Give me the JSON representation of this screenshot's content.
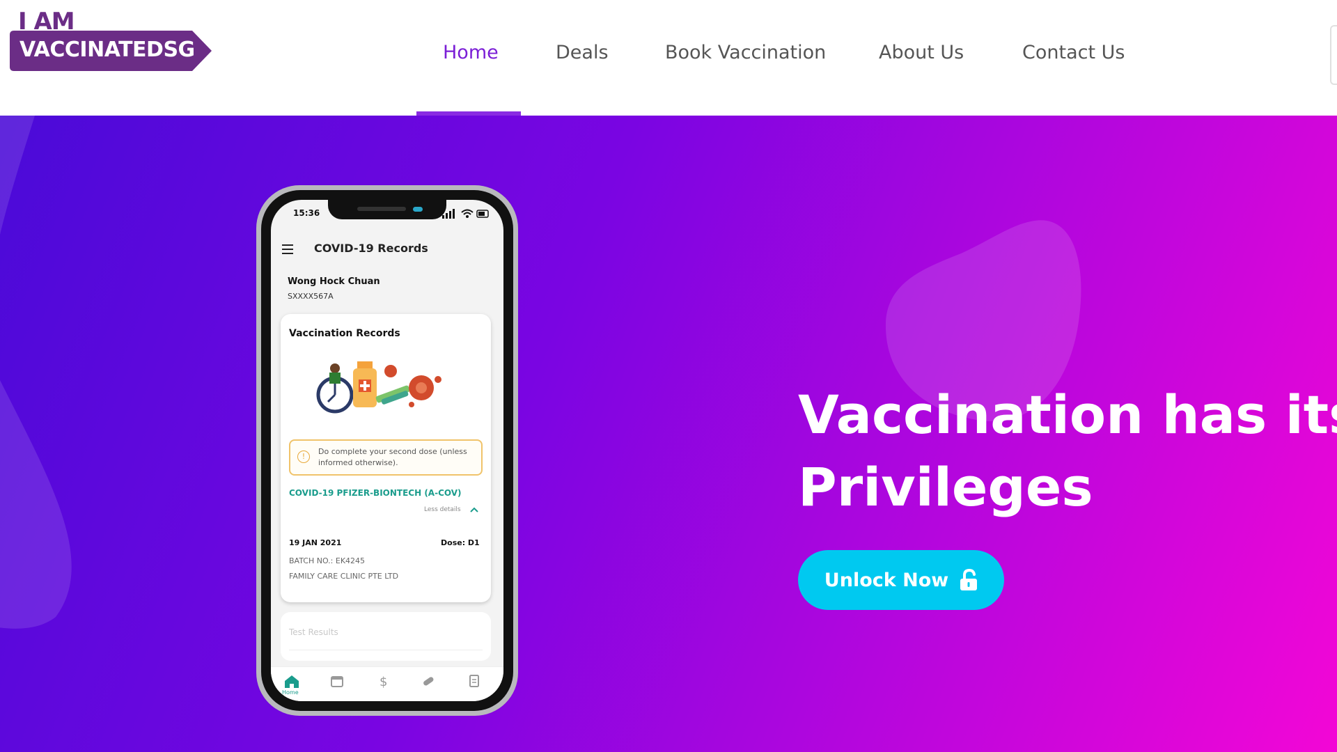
{
  "brand": {
    "logo_top": "I AM",
    "logo_bottom": "VACCINATEDSG",
    "logo_color": "#6b2d86"
  },
  "nav": {
    "items": [
      {
        "label": "Home",
        "active": true
      },
      {
        "label": "Deals",
        "active": false
      },
      {
        "label": "Book Vaccination",
        "active": false
      },
      {
        "label": "About Us",
        "active": false
      },
      {
        "label": "Contact Us",
        "active": false
      }
    ],
    "active_color": "#7b1fd6"
  },
  "hero": {
    "title_line1": "Vaccination has its",
    "title_line2": "Privileges",
    "cta_label": "Unlock Now",
    "cta_icon": "unlock-icon",
    "cta_color": "#00c9f0",
    "gradient": [
      "#4a0ad8",
      "#7a05e2",
      "#c006dc",
      "#f306d6"
    ]
  },
  "phone": {
    "status_time": "15:36",
    "app_title": "COVID-19 Records",
    "user_name": "Wong Hock Chuan",
    "user_id": "SXXXX567A",
    "card_title": "Vaccination Records",
    "notice": "Do complete your second dose (unless informed otherwise).",
    "vaccine_name": "COVID-19 PFIZER-BIONTECH (A-COV)",
    "less_details": "Less details",
    "dose_date": "19 JAN 2021",
    "dose_number": "Dose: D1",
    "batch": "BATCH NO.: EK4245",
    "clinic": "FAMILY CARE CLINIC PTE LTD",
    "test_results": "Test Results",
    "bottom_nav": {
      "home_label": "Home",
      "icons": [
        "home-icon",
        "calendar-icon",
        "dollar-icon",
        "pill-icon",
        "document-icon"
      ]
    },
    "accent_color": "#1a9c8c"
  }
}
